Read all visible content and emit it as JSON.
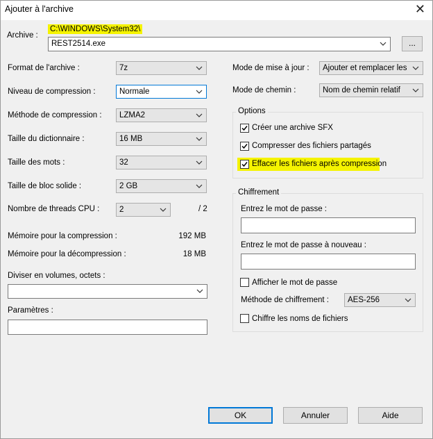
{
  "window": {
    "title": "Ajouter à l'archive",
    "close_glyph": "✕"
  },
  "archive": {
    "label": "Archive :",
    "path_hint": "C:\\WINDOWS\\System32\\",
    "filename": "REST2514.exe",
    "browse_label": "..."
  },
  "left": {
    "format_label": "Format de l'archive :",
    "format_value": "7z",
    "level_label": "Niveau de compression :",
    "level_value": "Normale",
    "method_label": "Méthode de compression :",
    "method_value": "LZMA2",
    "dict_label": "Taille du dictionnaire :",
    "dict_value": "16 MB",
    "word_label": "Taille des mots :",
    "word_value": "32",
    "solid_label": "Taille de bloc solide :",
    "solid_value": "2 GB",
    "threads_label": "Nombre de threads CPU :",
    "threads_value": "2",
    "threads_total": "/ 2",
    "mem_comp_label": "Mémoire pour la compression :",
    "mem_comp_value": "192 MB",
    "mem_decomp_label": "Mémoire pour la décompression :",
    "mem_decomp_value": "18 MB",
    "split_label": "Diviser en volumes, octets :",
    "split_value": "",
    "params_label": "Paramètres :",
    "params_value": ""
  },
  "right": {
    "update_label": "Mode de mise à jour :",
    "update_value": "Ajouter et remplacer les fichiers",
    "path_label": "Mode de chemin :",
    "path_value": "Nom de chemin relatif",
    "options": {
      "title": "Options",
      "sfx": {
        "label": "Créer une archive SFX",
        "checked": true
      },
      "shared": {
        "label": "Compresser des fichiers partagés",
        "checked": true
      },
      "delete": {
        "label": "Effacer les fichiers après compression",
        "checked": true
      }
    },
    "encryption": {
      "title": "Chiffrement",
      "pwd_label": "Entrez le mot de passe :",
      "pwd_value": "",
      "pwd2_label": "Entrez le mot de passe à nouveau :",
      "pwd2_value": "",
      "show_label": "Afficher le mot de passe",
      "show_checked": false,
      "method_label": "Méthode de chiffrement :",
      "method_value": "AES-256",
      "names_label": "Chiffre les noms de fichiers",
      "names_checked": false
    }
  },
  "buttons": {
    "ok": "OK",
    "cancel": "Annuler",
    "help": "Aide"
  },
  "colors": {
    "highlight": "#f5f300",
    "focus": "#0078d7"
  },
  "icons": {
    "dropdown": "chevron-down-icon",
    "checkbox": "checkmark-icon",
    "close": "close-icon"
  }
}
